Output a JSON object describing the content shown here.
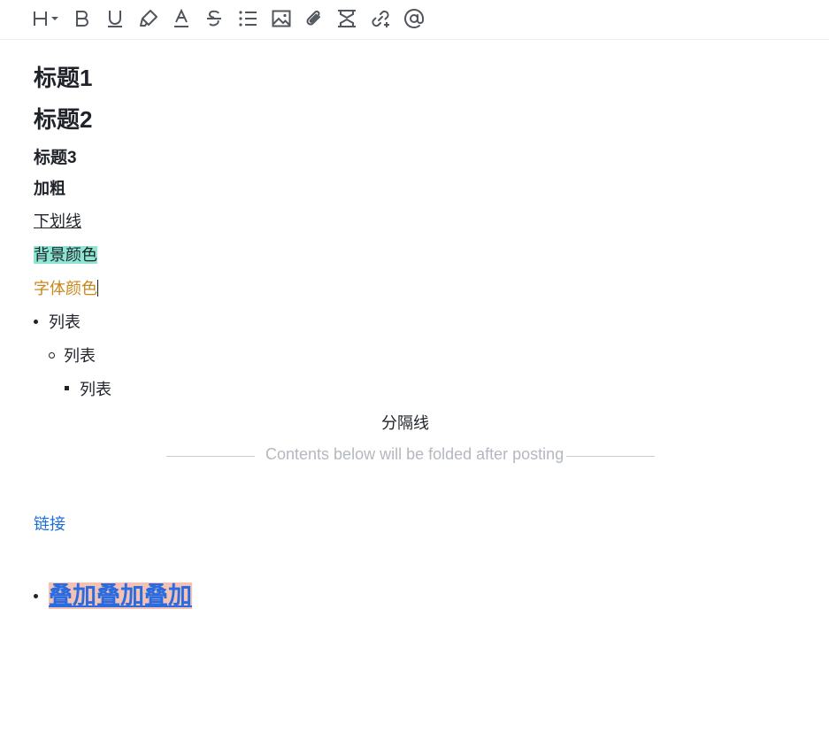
{
  "toolbar": {
    "buttons": [
      {
        "name": "heading-button",
        "icon": "heading-icon"
      },
      {
        "name": "bold-button",
        "icon": "bold-icon"
      },
      {
        "name": "underline-button",
        "icon": "underline-icon"
      },
      {
        "name": "highlight-button",
        "icon": "highlighter-icon"
      },
      {
        "name": "font-color-button",
        "icon": "font-color-icon"
      },
      {
        "name": "strikethrough-button",
        "icon": "strikethrough-icon"
      },
      {
        "name": "bullet-list-button",
        "icon": "list-icon"
      },
      {
        "name": "image-button",
        "icon": "image-icon"
      },
      {
        "name": "attachment-button",
        "icon": "paperclip-icon"
      },
      {
        "name": "fold-divider-button",
        "icon": "fold-icon"
      },
      {
        "name": "link-button",
        "icon": "link-add-icon"
      },
      {
        "name": "mention-button",
        "icon": "at-icon"
      }
    ]
  },
  "content": {
    "heading1": "标题1",
    "heading2": "标题2",
    "heading3": "标题3",
    "bold": "加粗",
    "underline": "下划线",
    "background_color": "背景颜色",
    "font_color": "字体颜色",
    "list_level1": "列表",
    "list_level2": "列表",
    "list_level3": "列表",
    "divider_label": "分隔线",
    "fold_text": "Contents below will be folded after posting",
    "link": "链接",
    "overlay": "叠加叠加叠加"
  },
  "colors": {
    "highlight_bg": "#8ee6d2",
    "font_color": "#c7871d",
    "link": "#1c6ed7",
    "overlay_text": "#2b6be0",
    "overlay_bg": "#f4c2b5"
  }
}
